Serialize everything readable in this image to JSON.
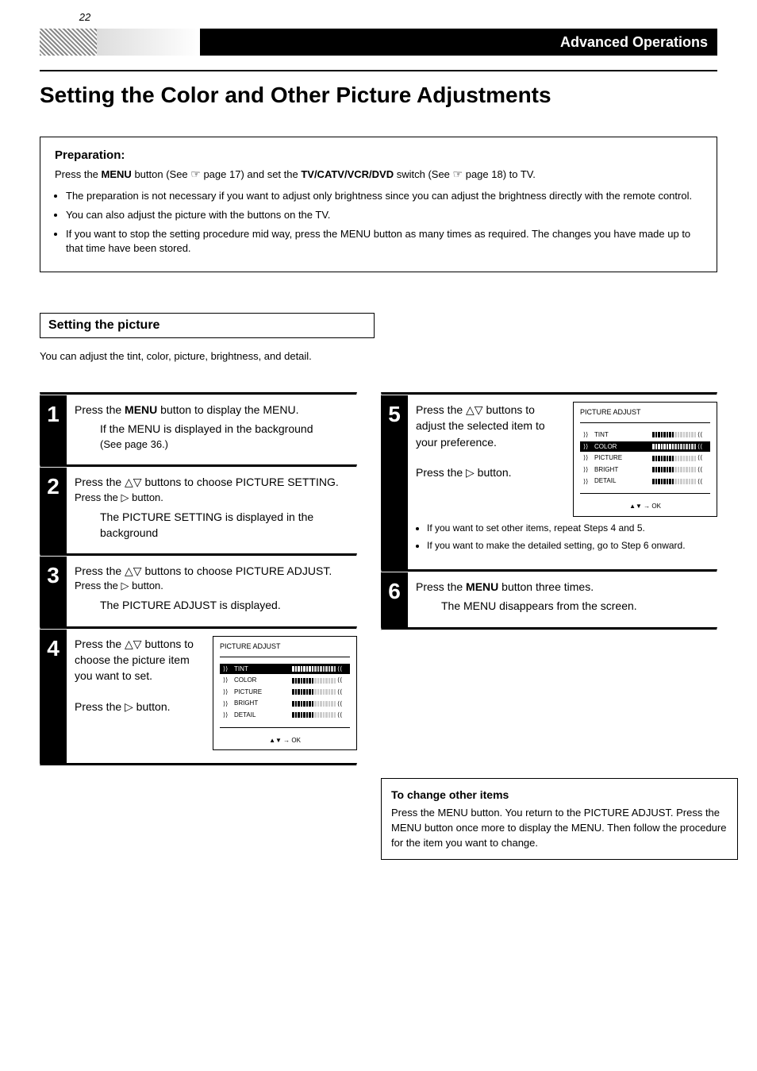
{
  "page_number": "22",
  "header": {
    "section": "Advanced Operations"
  },
  "chapter_title": "Setting the Color and Other Picture Adjustments",
  "prep": {
    "heading": "Preparation:",
    "line1_a": "Press the ",
    "line1_b": " button (See ",
    "line1_c": "  page 17) and set the ",
    "line1_d": " switch (See ",
    "line1_e": " page 18) to TV.",
    "menu_btn": "MENU",
    "tvvcr": "TV/CATV/VCR/DVD",
    "page_sym": "☞",
    "bullets": [
      "The preparation is not necessary if you want to adjust only brightness since you can adjust the brightness directly with the remote control.",
      "You can also adjust the picture with the buttons on the TV.",
      "If you want to stop the setting procedure mid way, press the MENU button as many times as required. The changes you have made up to that time have been stored."
    ]
  },
  "subheader": "Setting the picture",
  "intro": "You can adjust the tint, color, picture, brightness, and detail.",
  "steps": [
    {
      "num": "1",
      "lines": [
        "Press the <b>MENU</b> button to display the MENU.",
        "If the MENU is displayed in the background",
        "(See page 36.)"
      ]
    },
    {
      "num": "2",
      "lines": [
        "Press the △▽ buttons to choose PICTURE SETTING.",
        "Press the ▷ button."
      ],
      "after": "The PICTURE SETTING is displayed in the background"
    },
    {
      "num": "3",
      "lines": [
        "Press the △▽ buttons to choose PICTURE ADJUST.",
        "Press the ▷ button."
      ],
      "after": "The PICTURE ADJUST is displayed."
    },
    {
      "num": "4",
      "textlines": [
        "Press the △▽ buttons to choose the picture item you want to set.",
        "Press the ▷ button."
      ],
      "osd": {
        "title": "PICTURE ADJUST",
        "items": [
          {
            "label": "TINT",
            "selected": true
          },
          {
            "label": "COLOR",
            "selected": false
          },
          {
            "label": "PICTURE",
            "selected": false
          },
          {
            "label": "BRIGHT",
            "selected": false
          },
          {
            "label": "DETAIL",
            "selected": false
          }
        ],
        "hint": "▲▼ → OK"
      }
    },
    {
      "num": "5",
      "textlines": [
        "Press the △▽ buttons to adjust the selected item to your preference.",
        "Press the ▷ button."
      ],
      "osd": {
        "title": "PICTURE ADJUST",
        "items": [
          {
            "label": "TINT",
            "selected": false
          },
          {
            "label": "COLOR",
            "selected": true
          },
          {
            "label": "PICTURE",
            "selected": false
          },
          {
            "label": "BRIGHT",
            "selected": false
          },
          {
            "label": "DETAIL",
            "selected": false
          }
        ],
        "hint": "▲▼ → OK"
      },
      "bullets": [
        "If you want to set other items, repeat Steps 4 and 5.",
        "If you want to make the detailed setting, go to Step 6 onward."
      ]
    },
    {
      "num": "6",
      "lines": [
        "Press the <b>MENU</b> button three times.",
        "The MENU disappears from the screen."
      ]
    }
  ],
  "tochange": {
    "heading": "To change other items",
    "body": [
      "Press the MENU button. You return to the PICTURE ADJUST. Press the MENU button once more to display the MENU. Then follow the procedure for the item you want to change."
    ]
  }
}
